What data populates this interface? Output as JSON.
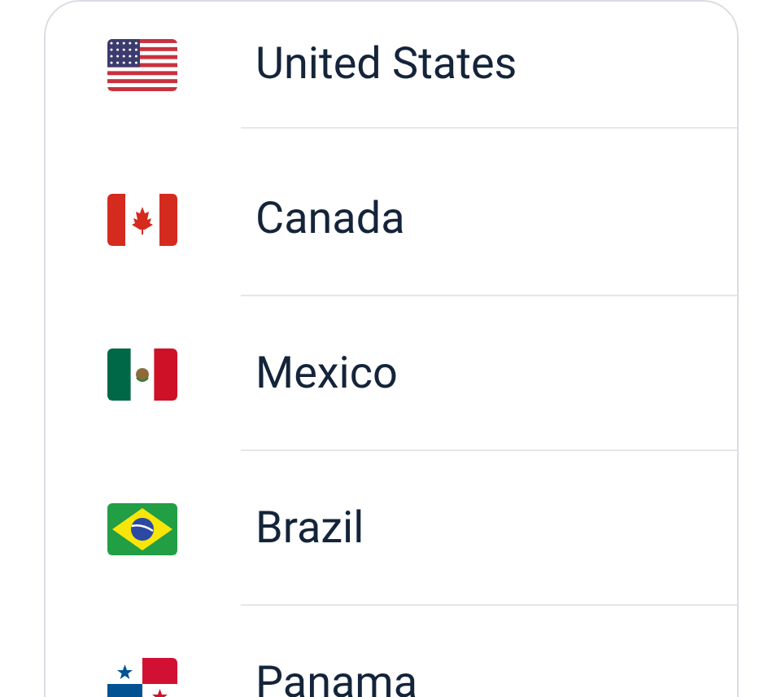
{
  "countries": [
    {
      "name": "United States",
      "kind": "us"
    },
    {
      "name": "Canada",
      "kind": "ca"
    },
    {
      "name": "Mexico",
      "kind": "mx"
    },
    {
      "name": "Brazil",
      "kind": "br"
    },
    {
      "name": "Panama",
      "kind": "pa"
    }
  ]
}
